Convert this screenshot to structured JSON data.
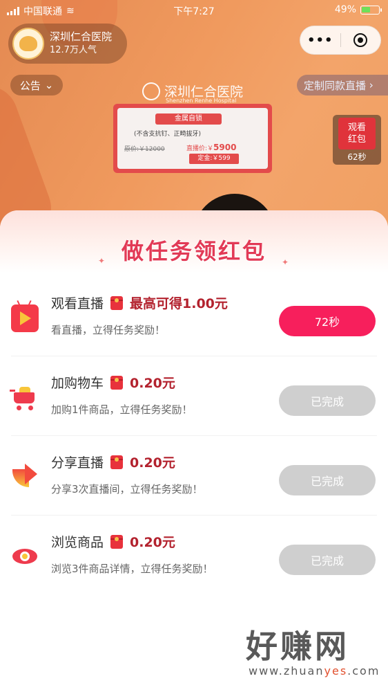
{
  "status_bar": {
    "carrier": "中国联通",
    "time": "下午7:27",
    "battery": "49%"
  },
  "live_room": {
    "host_name": "深圳仁合医院",
    "popularity": "12.7万人气",
    "notice_label": "公告",
    "custom_live_label": "定制同款直播",
    "hospital_sign": "深圳仁合医院",
    "hospital_sign_en": "Shenzhen Renhe Hospital",
    "poster": {
      "title": "金属自锁",
      "subtitle": "(不含支抗钉、正畸拔牙)",
      "original_price": "原价:￥12000",
      "live_price_label": "直播价:￥",
      "live_price": "5900",
      "deposit": "定金:￥599"
    },
    "watch_red_packet": {
      "label": "观看红包",
      "countdown": "62秒"
    }
  },
  "capsule": {
    "more_icon": "more-dots-icon",
    "close_icon": "target-icon"
  },
  "task_panel": {
    "title": "做任务领红包",
    "tasks": [
      {
        "icon": "tv-play-icon",
        "name": "观看直播",
        "reward": "最高可得1.00元",
        "desc": "看直播，立得任务奖励！",
        "button": "72秒",
        "state": "active"
      },
      {
        "icon": "shopping-cart-icon",
        "name": "加购物车",
        "reward": "0.20元",
        "desc": "加购1件商品，立得任务奖励！",
        "button": "已完成",
        "state": "done"
      },
      {
        "icon": "share-arrow-icon",
        "name": "分享直播",
        "reward": "0.20元",
        "desc": "分享3次直播间，立得任务奖励！",
        "button": "已完成",
        "state": "done"
      },
      {
        "icon": "eye-icon",
        "name": "浏览商品",
        "reward": "0.20元",
        "desc": "浏览3件商品详情，立得任务奖励！",
        "button": "已完成",
        "state": "done"
      }
    ]
  },
  "watermark": {
    "brand": "好赚网",
    "url_pre": "www.zhuan",
    "url_accent": "yes",
    "url_post": ".com"
  },
  "colors": {
    "primary_button": "#f71f5c",
    "done_button": "#cfcfcf",
    "reward_text": "#b3222e",
    "title_red": "#e23a56"
  }
}
